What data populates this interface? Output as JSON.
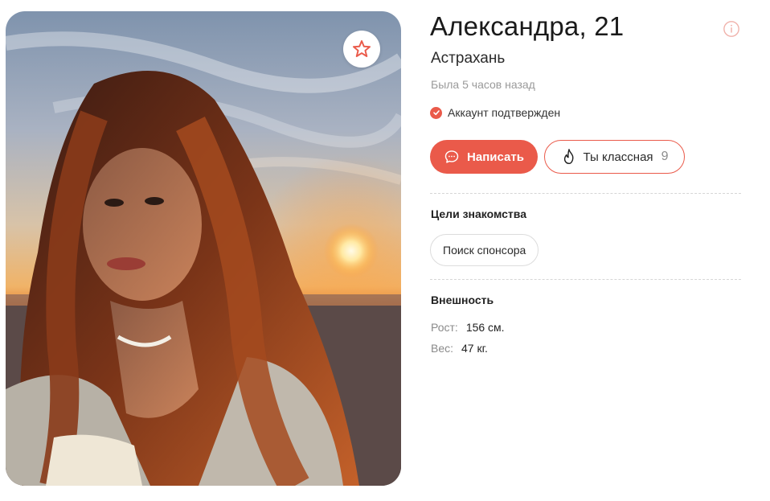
{
  "profile": {
    "name_age": "Александра, 21",
    "city": "Астрахань",
    "last_seen": "Была 5 часов назад",
    "verified_label": "Аккаунт подтвержден"
  },
  "actions": {
    "write_label": "Написать",
    "like_label": "Ты классная",
    "like_count": "9"
  },
  "goals": {
    "title": "Цели знакомства",
    "items": [
      "Поиск спонсора"
    ]
  },
  "appearance": {
    "title": "Внешность",
    "height_label": "Рост:",
    "height_value": "156 см.",
    "weight_label": "Вес:",
    "weight_value": "47 кг."
  },
  "icons": {
    "favorite": "star-icon",
    "report": "info-icon",
    "verified": "check-icon",
    "write": "chat-bubble-icon",
    "like": "flame-icon"
  },
  "colors": {
    "accent": "#ea5a4a",
    "muted_text": "#9a9a9a",
    "divider": "#d6d6d6"
  }
}
